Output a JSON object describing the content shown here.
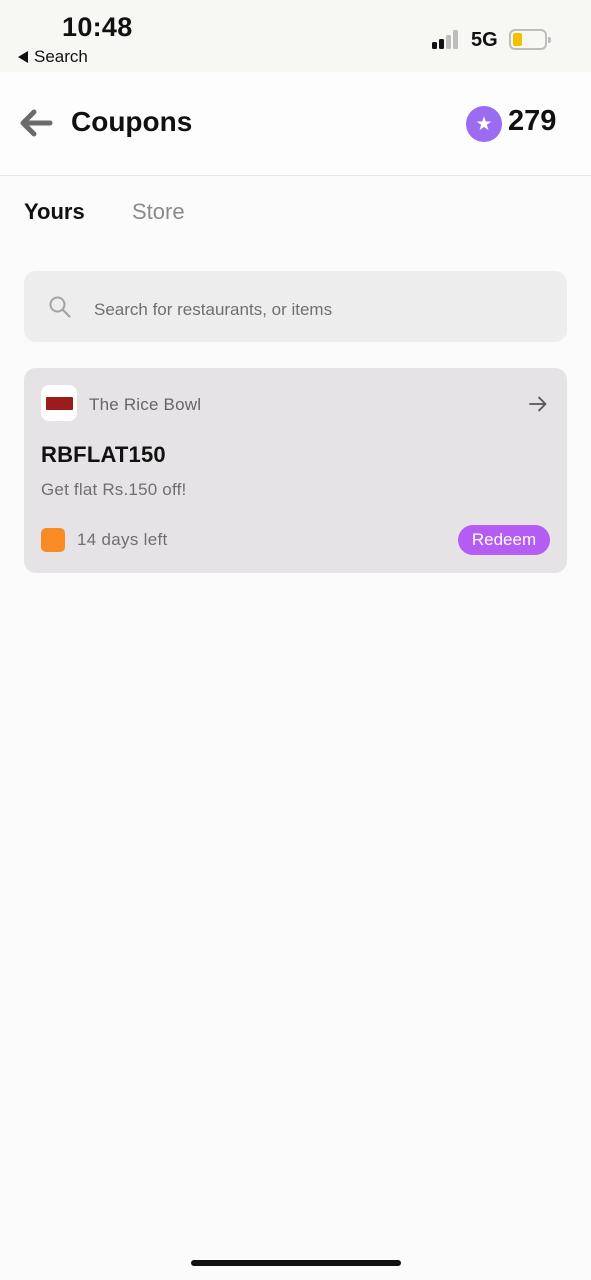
{
  "status_bar": {
    "time": "10:48",
    "back_label": "Search",
    "network": "5G",
    "signal_bars_active": 2,
    "signal_bars_total": 4,
    "battery_level_fraction": 0.25,
    "battery_color": "#f2c100"
  },
  "header": {
    "title": "Coupons",
    "points": "279",
    "points_icon": "star-icon",
    "points_icon_color": "#9b6cf2"
  },
  "tabs": [
    {
      "label": "Yours",
      "active": true
    },
    {
      "label": "Store",
      "active": false
    }
  ],
  "search": {
    "placeholder": "Search for restaurants, or items",
    "icon": "search-icon"
  },
  "coupons": [
    {
      "restaurant": "The Rice Bowl",
      "code": "RBFLAT150",
      "description": "Get flat Rs.150 off!",
      "expiry": "14 days left",
      "expiry_color": "#f98b24",
      "action_label": "Redeem",
      "action_color": "#b55cf2"
    }
  ]
}
